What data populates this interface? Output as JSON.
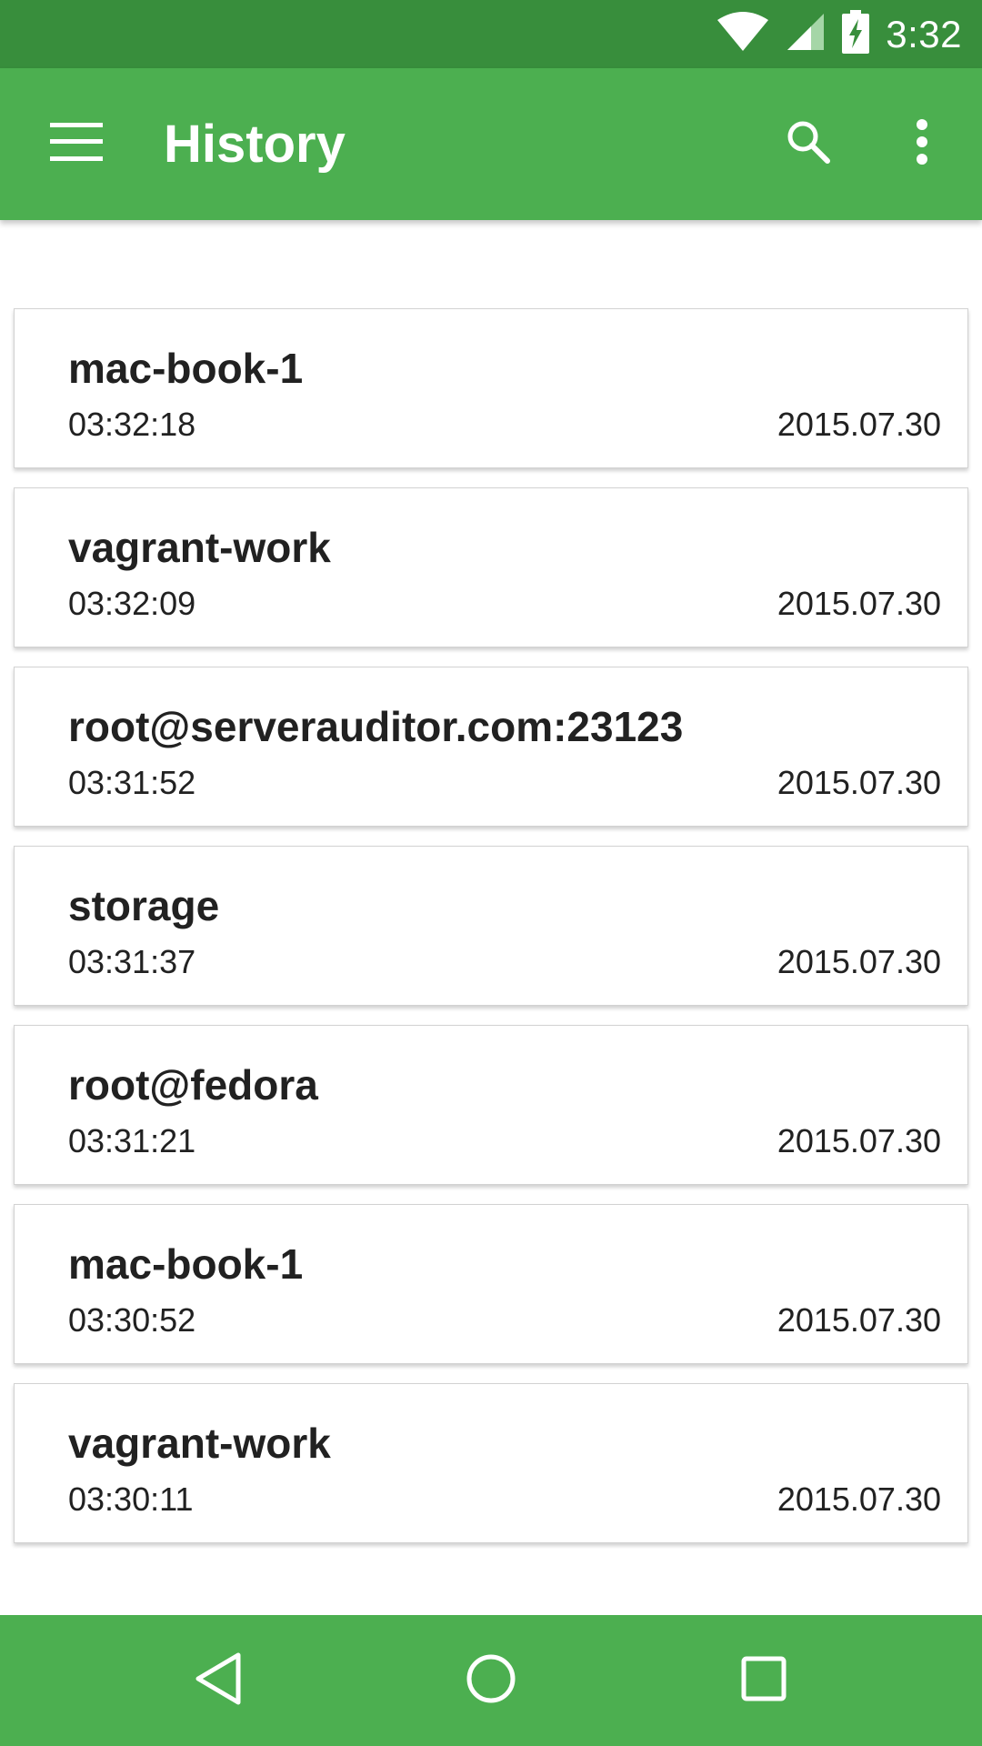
{
  "status_bar": {
    "time": "3:32",
    "icons": [
      "wifi-icon",
      "cell-signal-icon",
      "battery-charging-icon"
    ]
  },
  "app_bar": {
    "title": "History",
    "icons": [
      "menu-icon",
      "search-icon",
      "more-vert-icon"
    ]
  },
  "history": [
    {
      "host": "mac-book-1",
      "time": "03:32:18",
      "date": "2015.07.30"
    },
    {
      "host": "vagrant-work",
      "time": "03:32:09",
      "date": "2015.07.30"
    },
    {
      "host": "root@serverauditor.com:23123",
      "time": "03:31:52",
      "date": "2015.07.30"
    },
    {
      "host": "storage",
      "time": "03:31:37",
      "date": "2015.07.30"
    },
    {
      "host": "root@fedora",
      "time": "03:31:21",
      "date": "2015.07.30"
    },
    {
      "host": "mac-book-1",
      "time": "03:30:52",
      "date": "2015.07.30"
    },
    {
      "host": "vagrant-work",
      "time": "03:30:11",
      "date": "2015.07.30"
    }
  ],
  "nav_bar": {
    "icons": [
      "back-icon",
      "home-icon",
      "recents-icon"
    ]
  },
  "colors": {
    "status_bar": "#388e3c",
    "primary": "#4caf50",
    "text": "#212121",
    "card_border": "#d2d2d2"
  }
}
